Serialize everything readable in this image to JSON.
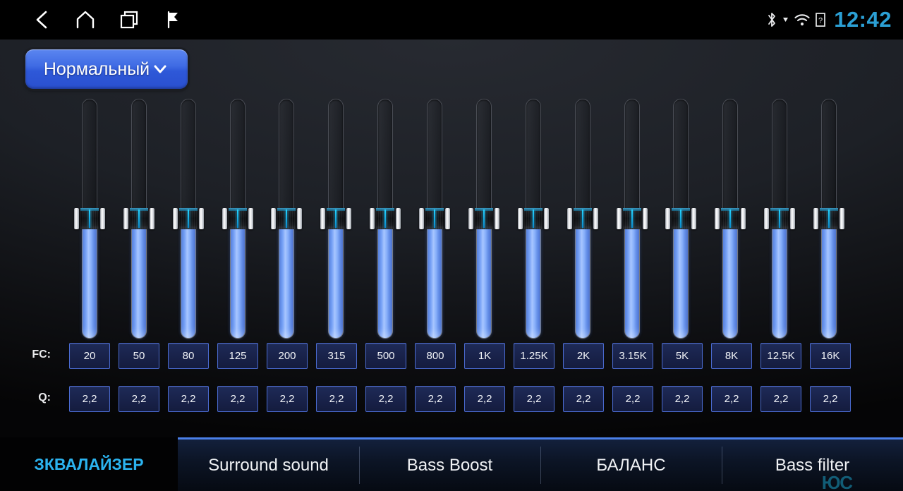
{
  "statusbar": {
    "nav": [
      {
        "name": "back-icon",
        "label": "Back"
      },
      {
        "name": "home-icon",
        "label": "Home"
      },
      {
        "name": "recents-icon",
        "label": "Recent apps"
      },
      {
        "name": "flag-icon",
        "label": "Flag"
      }
    ],
    "system_icons": [
      {
        "name": "bluetooth-icon",
        "label": "Bluetooth"
      },
      {
        "name": "download-arrow-icon",
        "label": "Download"
      },
      {
        "name": "wifi-icon",
        "label": "Wi-Fi"
      },
      {
        "name": "sim-unknown-icon",
        "label": "?"
      }
    ],
    "clock": "12:42",
    "clock_color": "#2b9fd4"
  },
  "preset": {
    "label": "Нормальный",
    "chevron": "chevron-down-icon",
    "accent": "#3f6be4"
  },
  "equalizer": {
    "fc_label": "FC:",
    "q_label": "Q:",
    "bands": [
      {
        "fc": "20",
        "q": "2,2",
        "level": 50
      },
      {
        "fc": "50",
        "q": "2,2",
        "level": 50
      },
      {
        "fc": "80",
        "q": "2,2",
        "level": 50
      },
      {
        "fc": "125",
        "q": "2,2",
        "level": 50
      },
      {
        "fc": "200",
        "q": "2,2",
        "level": 50
      },
      {
        "fc": "315",
        "q": "2,2",
        "level": 50
      },
      {
        "fc": "500",
        "q": "2,2",
        "level": 50
      },
      {
        "fc": "800",
        "q": "2,2",
        "level": 50
      },
      {
        "fc": "1K",
        "q": "2,2",
        "level": 50
      },
      {
        "fc": "1.25K",
        "q": "2,2",
        "level": 50
      },
      {
        "fc": "2K",
        "q": "2,2",
        "level": 50
      },
      {
        "fc": "3.15K",
        "q": "2,2",
        "level": 50
      },
      {
        "fc": "5K",
        "q": "2,2",
        "level": 50
      },
      {
        "fc": "8K",
        "q": "2,2",
        "level": 50
      },
      {
        "fc": "12.5K",
        "q": "2,2",
        "level": 50
      },
      {
        "fc": "16K",
        "q": "2,2",
        "level": 50
      }
    ]
  },
  "tabs": [
    {
      "label": "ЗКВАЛАЙЗЕР",
      "active": true
    },
    {
      "label": "Surround sound",
      "active": false
    },
    {
      "label": "Bass Boost",
      "active": false
    },
    {
      "label": "БАЛАНС",
      "active": false
    },
    {
      "label": "Bass filter",
      "active": false
    }
  ],
  "watermark": "ЮС"
}
